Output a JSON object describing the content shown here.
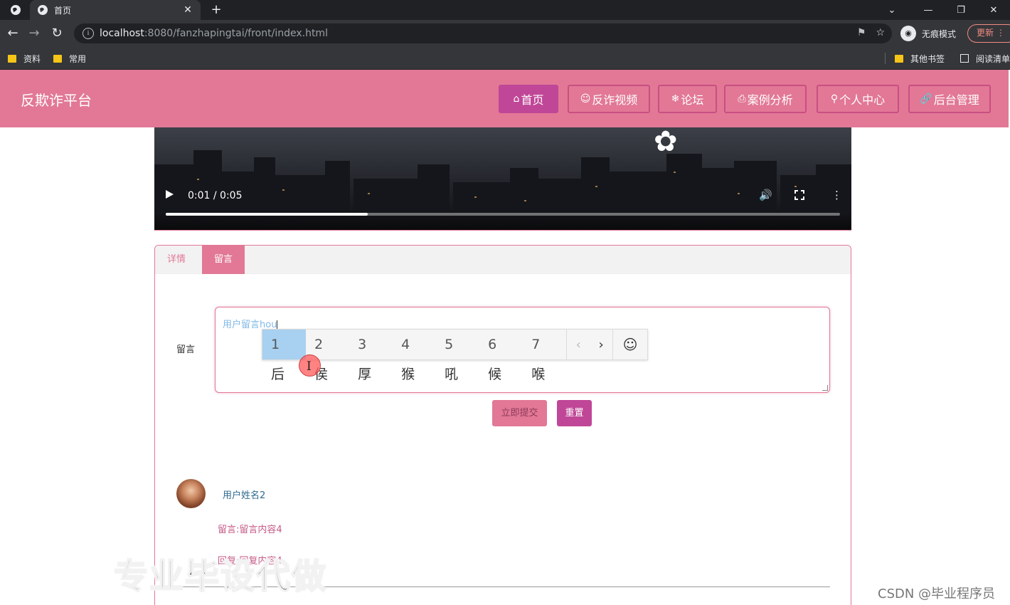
{
  "browser": {
    "tab_title": "首页",
    "url_host": "localhost",
    "url_path": ":8080/fanzhapingtai/front/index.html",
    "incognito_label": "无痕模式",
    "update_label": "更新",
    "bookmarks": [
      "资料",
      "常用"
    ],
    "other_bookmarks": "其他书签",
    "reading_list": "阅读清单"
  },
  "site": {
    "title": "反欺诈平台",
    "nav": [
      {
        "icon": "⌂",
        "label": "首页",
        "active": true
      },
      {
        "icon": "☺",
        "label": "反诈视频"
      },
      {
        "icon": "❄",
        "label": "论坛"
      },
      {
        "icon": "⎙",
        "label": "案例分析"
      },
      {
        "icon": "⚲",
        "label": "个人中心"
      },
      {
        "icon": "🔗",
        "label": "后台管理"
      }
    ]
  },
  "video": {
    "time": "0:01 / 0:05",
    "progress": 0.3
  },
  "panel": {
    "tabs": [
      "详情",
      "留言"
    ],
    "active_tab": 1,
    "field_label": "留言",
    "textarea_value": "用户留言hou",
    "submit_label": "立即提交",
    "reset_label": "重置"
  },
  "ime": {
    "candidates": [
      {
        "num": "1",
        "char": "后"
      },
      {
        "num": "2",
        "char": "侯"
      },
      {
        "num": "3",
        "char": "厚"
      },
      {
        "num": "4",
        "char": "猴"
      },
      {
        "num": "5",
        "char": "吼"
      },
      {
        "num": "6",
        "char": "候"
      },
      {
        "num": "7",
        "char": "喉"
      }
    ],
    "prev": "‹",
    "next": "›",
    "emoji": "☺"
  },
  "comments": [
    {
      "user": "用户姓名2",
      "content": "留言:留言内容4",
      "reply": "回复:回复内容4"
    }
  ],
  "overlay": {
    "watermark": "专业毕设代做",
    "csdn": "CSDN @毕业程序员"
  },
  "colors": {
    "header_pink": "#e27896",
    "active_purple": "#c04697"
  }
}
